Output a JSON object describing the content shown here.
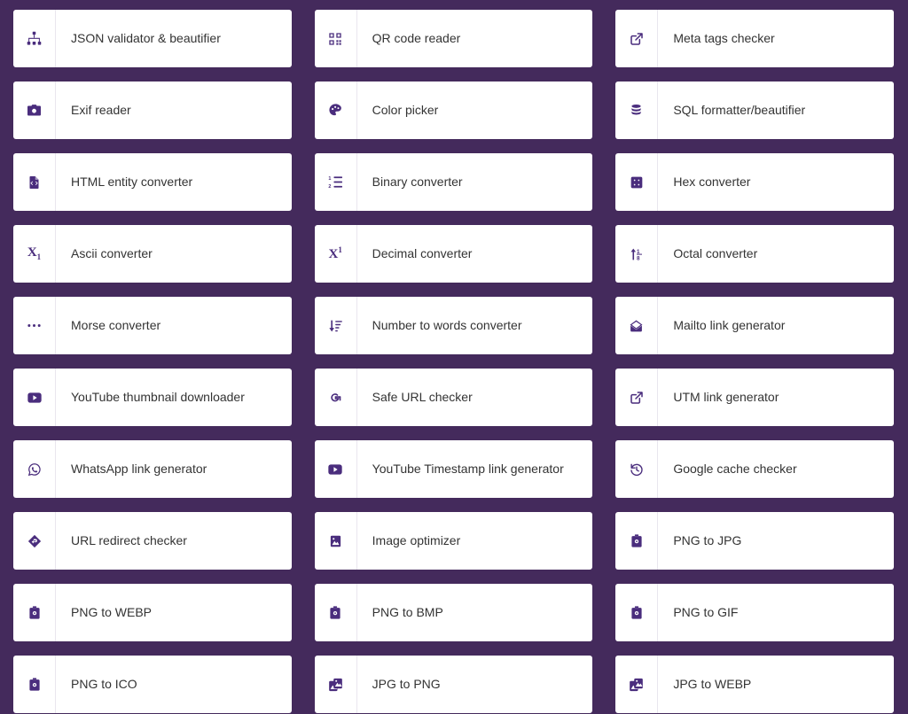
{
  "page": {
    "background_color": "#442a5c",
    "card_background_color": "#ffffff",
    "icon_color": "#4a2d7d",
    "label_color": "#333333",
    "divider_color": "#e9e6ee",
    "columns": 3
  },
  "tools": [
    {
      "label": "JSON validator & beautifier",
      "icon": "sitemap-icon"
    },
    {
      "label": "QR code reader",
      "icon": "qr-code-icon"
    },
    {
      "label": "Meta tags checker",
      "icon": "external-link-icon"
    },
    {
      "label": "Exif reader",
      "icon": "camera-icon"
    },
    {
      "label": "Color picker",
      "icon": "palette-icon"
    },
    {
      "label": "SQL formatter/beautifier",
      "icon": "database-icon"
    },
    {
      "label": "HTML entity converter",
      "icon": "file-code-icon"
    },
    {
      "label": "Binary converter",
      "icon": "ordered-list-icon"
    },
    {
      "label": "Hex converter",
      "icon": "hex-grid-icon"
    },
    {
      "label": "Ascii converter",
      "icon": "subscript-icon"
    },
    {
      "label": "Decimal converter",
      "icon": "superscript-icon"
    },
    {
      "label": "Octal converter",
      "icon": "arrow-up-down-icon"
    },
    {
      "label": "Morse converter",
      "icon": "ellipsis-icon"
    },
    {
      "label": "Number to words converter",
      "icon": "sort-descending-icon"
    },
    {
      "label": "Mailto link generator",
      "icon": "envelope-icon"
    },
    {
      "label": "YouTube thumbnail downloader",
      "icon": "youtube-play-icon"
    },
    {
      "label": "Safe URL checker",
      "icon": "google-g-icon"
    },
    {
      "label": "UTM link generator",
      "icon": "external-link-icon"
    },
    {
      "label": "WhatsApp link generator",
      "icon": "whatsapp-icon"
    },
    {
      "label": "YouTube Timestamp link generator",
      "icon": "youtube-play-icon"
    },
    {
      "label": "Google cache checker",
      "icon": "history-icon"
    },
    {
      "label": "URL redirect checker",
      "icon": "redirect-diamond-icon"
    },
    {
      "label": "Image optimizer",
      "icon": "image-icon"
    },
    {
      "label": "PNG to JPG",
      "icon": "file-image-icon"
    },
    {
      "label": "PNG to WEBP",
      "icon": "file-image-icon"
    },
    {
      "label": "PNG to BMP",
      "icon": "file-image-icon"
    },
    {
      "label": "PNG to GIF",
      "icon": "file-image-icon"
    },
    {
      "label": "PNG to ICO",
      "icon": "file-image-icon"
    },
    {
      "label": "JPG to PNG",
      "icon": "images-stack-icon"
    },
    {
      "label": "JPG to WEBP",
      "icon": "images-stack-icon"
    }
  ]
}
